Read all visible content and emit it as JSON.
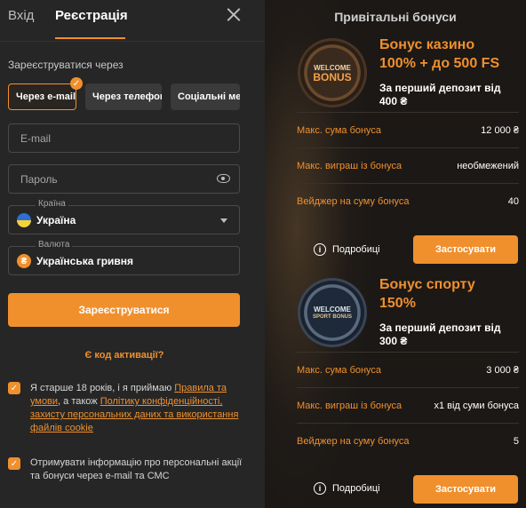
{
  "tabs": {
    "login": "Вхід",
    "register": "Реєстрація"
  },
  "register_via": "Зареєструватися через",
  "methods": [
    "Через e-mail",
    "Через телефон",
    "Соціальні мережі"
  ],
  "form": {
    "email_placeholder": "E-mail",
    "password_placeholder": "Пароль",
    "country_label": "Країна",
    "country_value": "Україна",
    "currency_label": "Валюта",
    "currency_value": "Українська гривня",
    "currency_symbol": "₴"
  },
  "register_button": "Зареєструватися",
  "promo_link": "Є код активації?",
  "consent": {
    "age_prefix": "Я старше 18 років, і я приймаю ",
    "terms_link": "Правила та умови",
    "mid": ", а також ",
    "privacy_link": "Політику конфіденційності, захисту персональних даних та використання файлів cookie",
    "promo_text": "Отримувати інформацію про персональні акції та бонуси через e-mail та СМС"
  },
  "bonuses_title": "Привітальні бонуси",
  "bonuses": [
    {
      "badge_top": "WELCOME",
      "badge_bottom": "BONUS",
      "title_line1": "Бонус казино",
      "title_line2": "100% + до 500 FS",
      "subtitle": "За перший депозит від 400 ₴",
      "rows": [
        {
          "k": "Макс. сума бонуса",
          "v": "12 000 ₴"
        },
        {
          "k": "Макс. виграш із бонуса",
          "v": "необмежений"
        },
        {
          "k": "Вейджер на суму бонуса",
          "v": "40"
        }
      ],
      "details": "Подробиці",
      "apply": "Застосувати"
    },
    {
      "badge_top": "WELCOME",
      "badge_bottom": "SPORT BONUS",
      "title_line1": "Бонус спорту",
      "title_line2": "150%",
      "subtitle": "За перший депозит від 300 ₴",
      "rows": [
        {
          "k": "Макс. сума бонуса",
          "v": "3 000 ₴"
        },
        {
          "k": "Макс. виграш із бонуса",
          "v": "х1 від суми бонуса"
        },
        {
          "k": "Вейджер на суму бонуса",
          "v": "5"
        }
      ],
      "details": "Подробиці",
      "apply": "Застосувати"
    }
  ],
  "colors": {
    "accent": "#f0902d",
    "panel": "#262626",
    "right_bg": "#1b1816"
  }
}
